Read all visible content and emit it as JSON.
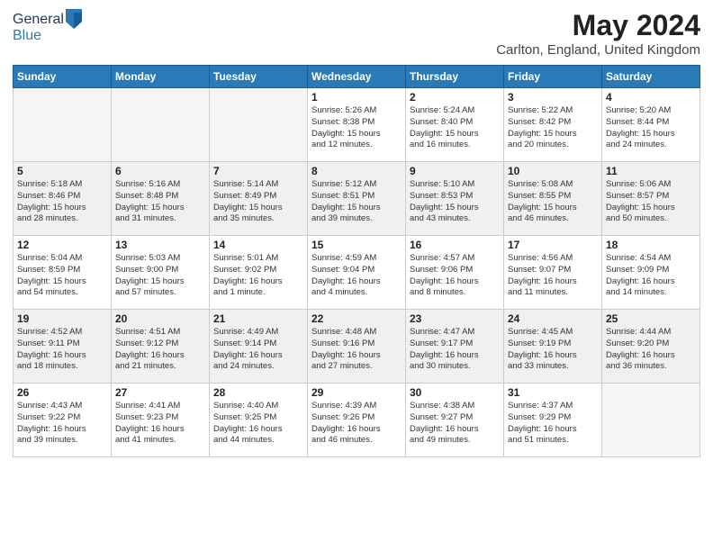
{
  "header": {
    "logo_general": "General",
    "logo_blue": "Blue",
    "title": "May 2024",
    "subtitle": "Carlton, England, United Kingdom"
  },
  "columns": [
    "Sunday",
    "Monday",
    "Tuesday",
    "Wednesday",
    "Thursday",
    "Friday",
    "Saturday"
  ],
  "weeks": [
    [
      {
        "day": "",
        "info": ""
      },
      {
        "day": "",
        "info": ""
      },
      {
        "day": "",
        "info": ""
      },
      {
        "day": "1",
        "info": "Sunrise: 5:26 AM\nSunset: 8:38 PM\nDaylight: 15 hours\nand 12 minutes."
      },
      {
        "day": "2",
        "info": "Sunrise: 5:24 AM\nSunset: 8:40 PM\nDaylight: 15 hours\nand 16 minutes."
      },
      {
        "day": "3",
        "info": "Sunrise: 5:22 AM\nSunset: 8:42 PM\nDaylight: 15 hours\nand 20 minutes."
      },
      {
        "day": "4",
        "info": "Sunrise: 5:20 AM\nSunset: 8:44 PM\nDaylight: 15 hours\nand 24 minutes."
      }
    ],
    [
      {
        "day": "5",
        "info": "Sunrise: 5:18 AM\nSunset: 8:46 PM\nDaylight: 15 hours\nand 28 minutes."
      },
      {
        "day": "6",
        "info": "Sunrise: 5:16 AM\nSunset: 8:48 PM\nDaylight: 15 hours\nand 31 minutes."
      },
      {
        "day": "7",
        "info": "Sunrise: 5:14 AM\nSunset: 8:49 PM\nDaylight: 15 hours\nand 35 minutes."
      },
      {
        "day": "8",
        "info": "Sunrise: 5:12 AM\nSunset: 8:51 PM\nDaylight: 15 hours\nand 39 minutes."
      },
      {
        "day": "9",
        "info": "Sunrise: 5:10 AM\nSunset: 8:53 PM\nDaylight: 15 hours\nand 43 minutes."
      },
      {
        "day": "10",
        "info": "Sunrise: 5:08 AM\nSunset: 8:55 PM\nDaylight: 15 hours\nand 46 minutes."
      },
      {
        "day": "11",
        "info": "Sunrise: 5:06 AM\nSunset: 8:57 PM\nDaylight: 15 hours\nand 50 minutes."
      }
    ],
    [
      {
        "day": "12",
        "info": "Sunrise: 5:04 AM\nSunset: 8:59 PM\nDaylight: 15 hours\nand 54 minutes."
      },
      {
        "day": "13",
        "info": "Sunrise: 5:03 AM\nSunset: 9:00 PM\nDaylight: 15 hours\nand 57 minutes."
      },
      {
        "day": "14",
        "info": "Sunrise: 5:01 AM\nSunset: 9:02 PM\nDaylight: 16 hours\nand 1 minute."
      },
      {
        "day": "15",
        "info": "Sunrise: 4:59 AM\nSunset: 9:04 PM\nDaylight: 16 hours\nand 4 minutes."
      },
      {
        "day": "16",
        "info": "Sunrise: 4:57 AM\nSunset: 9:06 PM\nDaylight: 16 hours\nand 8 minutes."
      },
      {
        "day": "17",
        "info": "Sunrise: 4:56 AM\nSunset: 9:07 PM\nDaylight: 16 hours\nand 11 minutes."
      },
      {
        "day": "18",
        "info": "Sunrise: 4:54 AM\nSunset: 9:09 PM\nDaylight: 16 hours\nand 14 minutes."
      }
    ],
    [
      {
        "day": "19",
        "info": "Sunrise: 4:52 AM\nSunset: 9:11 PM\nDaylight: 16 hours\nand 18 minutes."
      },
      {
        "day": "20",
        "info": "Sunrise: 4:51 AM\nSunset: 9:12 PM\nDaylight: 16 hours\nand 21 minutes."
      },
      {
        "day": "21",
        "info": "Sunrise: 4:49 AM\nSunset: 9:14 PM\nDaylight: 16 hours\nand 24 minutes."
      },
      {
        "day": "22",
        "info": "Sunrise: 4:48 AM\nSunset: 9:16 PM\nDaylight: 16 hours\nand 27 minutes."
      },
      {
        "day": "23",
        "info": "Sunrise: 4:47 AM\nSunset: 9:17 PM\nDaylight: 16 hours\nand 30 minutes."
      },
      {
        "day": "24",
        "info": "Sunrise: 4:45 AM\nSunset: 9:19 PM\nDaylight: 16 hours\nand 33 minutes."
      },
      {
        "day": "25",
        "info": "Sunrise: 4:44 AM\nSunset: 9:20 PM\nDaylight: 16 hours\nand 36 minutes."
      }
    ],
    [
      {
        "day": "26",
        "info": "Sunrise: 4:43 AM\nSunset: 9:22 PM\nDaylight: 16 hours\nand 39 minutes."
      },
      {
        "day": "27",
        "info": "Sunrise: 4:41 AM\nSunset: 9:23 PM\nDaylight: 16 hours\nand 41 minutes."
      },
      {
        "day": "28",
        "info": "Sunrise: 4:40 AM\nSunset: 9:25 PM\nDaylight: 16 hours\nand 44 minutes."
      },
      {
        "day": "29",
        "info": "Sunrise: 4:39 AM\nSunset: 9:26 PM\nDaylight: 16 hours\nand 46 minutes."
      },
      {
        "day": "30",
        "info": "Sunrise: 4:38 AM\nSunset: 9:27 PM\nDaylight: 16 hours\nand 49 minutes."
      },
      {
        "day": "31",
        "info": "Sunrise: 4:37 AM\nSunset: 9:29 PM\nDaylight: 16 hours\nand 51 minutes."
      },
      {
        "day": "",
        "info": ""
      }
    ]
  ]
}
